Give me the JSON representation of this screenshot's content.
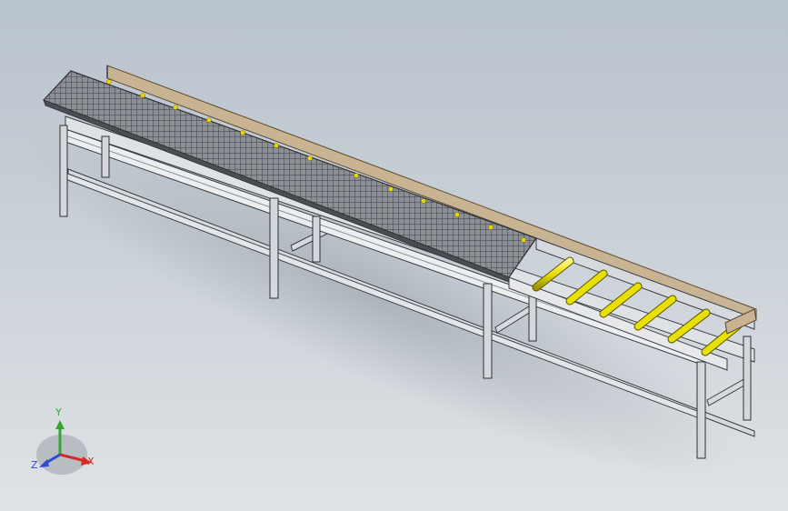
{
  "viewport": {
    "background_top": "#b9c3cd",
    "background_bottom": "#dfe3e6"
  },
  "model": {
    "frame_color": "#c9cdd2",
    "frame_dark": "#3a3d42",
    "mesh_color": "#6f7378",
    "board_color": "#c8b493",
    "roller_color": "#e8e000",
    "roller_count_visible": 6
  },
  "triad": {
    "x_label": "X",
    "y_label": "Y",
    "z_label": "Z",
    "x_color": "#d22b2b",
    "y_color": "#2fa82f",
    "z_color": "#2b4bd2"
  }
}
